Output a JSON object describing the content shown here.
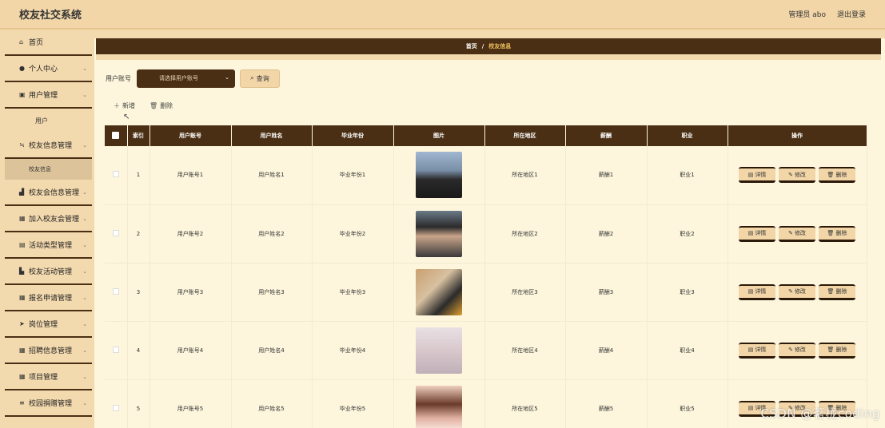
{
  "header": {
    "app_title": "校友社交系统",
    "user_label": "管理员 abo",
    "logout_label": "退出登录"
  },
  "sidebar": {
    "items": [
      {
        "label": "首页",
        "icon": "home-icon",
        "has_chevron": false
      },
      {
        "label": "个人中心",
        "icon": "user-icon",
        "has_chevron": true
      },
      {
        "label": "用户管理",
        "icon": "folder-icon",
        "has_chevron": true
      },
      {
        "label": "用户",
        "sub": true
      },
      {
        "label": "校友信息管理",
        "icon": "sliders-icon",
        "has_chevron": true
      },
      {
        "label": "校友信息",
        "sub": true,
        "active": true
      },
      {
        "label": "校友会信息管理",
        "icon": "bank-icon",
        "has_chevron": true
      },
      {
        "label": "加入校友会管理",
        "icon": "grid-icon",
        "has_chevron": true
      },
      {
        "label": "活动类型管理",
        "icon": "clipboard-icon",
        "has_chevron": true
      },
      {
        "label": "校友活动管理",
        "icon": "chart-icon",
        "has_chevron": true
      },
      {
        "label": "报名申请管理",
        "icon": "grid-icon",
        "has_chevron": true
      },
      {
        "label": "岗位管理",
        "icon": "send-icon",
        "has_chevron": true
      },
      {
        "label": "招聘信息管理",
        "icon": "grid-icon",
        "has_chevron": true
      },
      {
        "label": "项目管理",
        "icon": "grid-icon",
        "has_chevron": true
      },
      {
        "label": "校园捐赠管理",
        "icon": "menu-icon",
        "has_chevron": true
      }
    ]
  },
  "breadcrumb": {
    "home": "首页",
    "separator": "/",
    "current": "校友信息"
  },
  "search": {
    "label": "用户账号",
    "select_placeholder": "请选择用户账号",
    "button_label": "查询"
  },
  "actions": {
    "add_label": "新增",
    "delete_label": "删除"
  },
  "table": {
    "headers": [
      "索引",
      "用户账号",
      "用户姓名",
      "毕业年份",
      "图片",
      "所在地区",
      "薪酬",
      "职业",
      "操作"
    ],
    "rows": [
      {
        "index": "1",
        "account": "用户账号1",
        "name": "用户姓名1",
        "year": "毕业年份1",
        "region": "所在地区1",
        "salary": "薪酬1",
        "job": "职业1",
        "image": "dog-photo"
      },
      {
        "index": "2",
        "account": "用户账号2",
        "name": "用户姓名2",
        "year": "毕业年份2",
        "region": "所在地区2",
        "salary": "薪酬2",
        "job": "职业2",
        "image": "man-portrait-photo"
      },
      {
        "index": "3",
        "account": "用户账号3",
        "name": "用户姓名3",
        "year": "毕业年份3",
        "region": "所在地区3",
        "salary": "薪酬3",
        "job": "职业3",
        "image": "young-man-photo"
      },
      {
        "index": "4",
        "account": "用户账号4",
        "name": "用户姓名4",
        "year": "毕业年份4",
        "region": "所在地区4",
        "salary": "薪酬4",
        "job": "职业4",
        "image": "woman-portrait-photo"
      },
      {
        "index": "5",
        "account": "用户账号5",
        "name": "用户姓名5",
        "year": "毕业年份5",
        "region": "所在地区5",
        "salary": "薪酬5",
        "job": "职业5",
        "image": "anime-girl-illustration"
      }
    ],
    "row_actions": {
      "detail": "详情",
      "edit": "修改",
      "delete": "删除"
    }
  },
  "watermark": "CSDN @茗栊coding",
  "colors": {
    "header_bg": "#f2d6a8",
    "dark_brown": "#4a2f14",
    "page_bg": "#fdf6dc",
    "breadcrumb_current": "#f0c060"
  }
}
